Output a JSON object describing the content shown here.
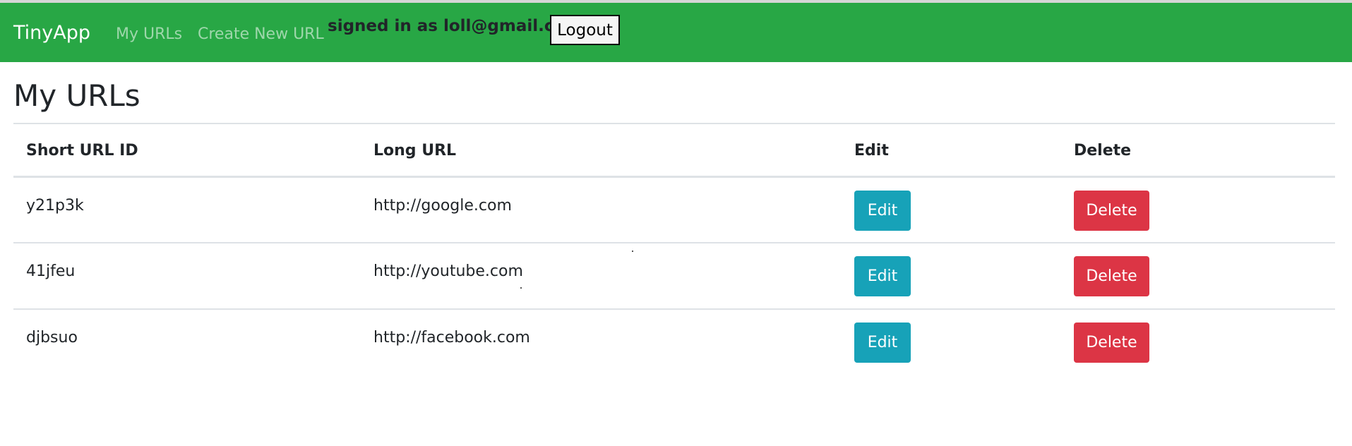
{
  "navbar": {
    "brand": "TinyApp",
    "links": [
      "My URLs",
      "Create New URL"
    ],
    "signed_in_text": "signed in as loll@gmail.com",
    "logout_label": "Logout",
    "bg_color": "#28a745"
  },
  "main": {
    "title": "My URLs",
    "table": {
      "headers": [
        "Short URL ID",
        "Long URL",
        "Edit",
        "Delete"
      ],
      "rows": [
        {
          "short": "y21p3k",
          "long": "http://google.com",
          "edit": "Edit",
          "delete": "Delete"
        },
        {
          "short": "41jfeu",
          "long": "http://youtube.com",
          "edit": "Edit",
          "delete": "Delete"
        },
        {
          "short": "djbsuo",
          "long": "http://facebook.com",
          "edit": "Edit",
          "delete": "Delete"
        }
      ]
    },
    "colors": {
      "edit_button": "#17a2b8",
      "delete_button": "#dc3545"
    }
  }
}
